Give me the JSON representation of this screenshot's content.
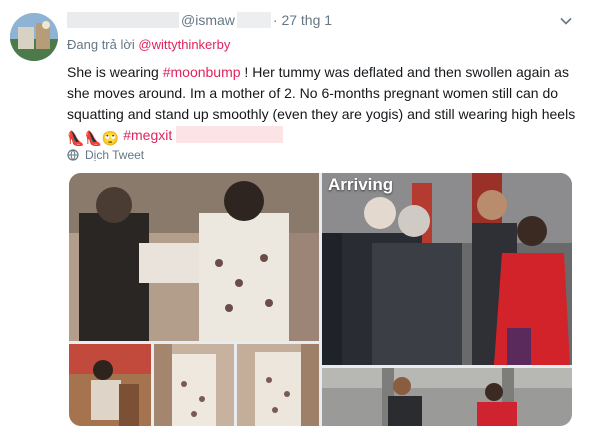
{
  "tweet": {
    "handle": "@ismaw",
    "date": "· 27 thg 1",
    "reply_prefix": "Đang trả lời ",
    "reply_mention": "@wittythinkerby",
    "body_parts": {
      "p1": "She is wearing ",
      "tag1": "#moonbump",
      "p2": " ! Her tummy was deflated and then swollen again as she moves around. Im a mother of 2. No 6-months pregnant women still can do squatting and stand up smoothly (even they are yogis) and still wearing high heels ",
      "emoji_1": "👠",
      "emoji_2": "👠",
      "emoji_3": "🙄",
      "tag2": "#megxit"
    },
    "translate_label": "Dịch Tweet",
    "media_caption": "Arriving"
  },
  "colors": {
    "accent": "#e0245e",
    "muted": "#657786",
    "text": "#14171a"
  },
  "icons": {
    "globe": "globe-icon",
    "chevron": "chevron-down-icon"
  }
}
